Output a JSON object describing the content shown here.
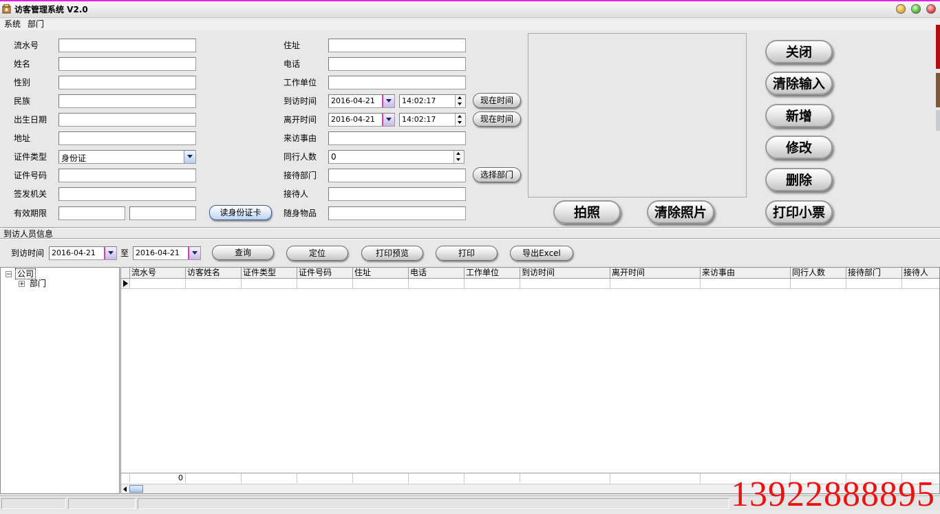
{
  "window": {
    "title": "访客管理系统 V2.0"
  },
  "menu": [
    "系统",
    "部门"
  ],
  "form": {
    "serial_label": "流水号",
    "serial_value": "",
    "name_label": "姓名",
    "name_value": "",
    "gender_label": "性别",
    "gender_value": "",
    "ethnicity_label": "民族",
    "ethnicity_value": "",
    "birthdate_label": "出生日期",
    "birthdate_value": "",
    "address_label": "地址",
    "address_value": "",
    "id_type_label": "证件类型",
    "id_type_value": "身份证",
    "id_number_label": "证件号码",
    "id_number_value": "",
    "issuer_label": "签发机关",
    "issuer_value": "",
    "validity_label": "有效期限",
    "validity_from": "",
    "validity_to": "",
    "read_card_button": "读身份证卡",
    "residence_label": "住址",
    "residence_value": "",
    "phone_label": "电话",
    "phone_value": "",
    "workplace_label": "工作单位",
    "workplace_value": "",
    "arrival_label": "到访时间",
    "arrival_date": "2016-04-21",
    "arrival_time": "14:02:17",
    "leave_label": "离开时间",
    "leave_date": "2016-04-21",
    "leave_time": "14:02:17",
    "now_button": "现在时间",
    "reason_label": "来访事由",
    "reason_value": "",
    "companions_label": "同行人数",
    "companions_value": "0",
    "host_dept_label": "接待部门",
    "host_dept_value": "",
    "select_dept_button": "选择部门",
    "host_label": "接待人",
    "host_value": "",
    "belongings_label": "随身物品",
    "belongings_value": ""
  },
  "photo_buttons": {
    "take": "拍照",
    "clear": "清除照片"
  },
  "actions": [
    "关闭",
    "清除输入",
    "新增",
    "修改",
    "删除",
    "打印小票"
  ],
  "section_title": "到访人员信息",
  "query": {
    "label": "到访时间",
    "from": "2016-04-21",
    "to_label": "至",
    "to": "2016-04-21",
    "buttons": [
      "查询",
      "定位",
      "打印预览",
      "打印",
      "导出Excel"
    ]
  },
  "tree": {
    "root": "公司",
    "child": "部门"
  },
  "grid": {
    "columns": [
      "流水号",
      "访客姓名",
      "证件类型",
      "证件号码",
      "住址",
      "电话",
      "工作单位",
      "到访时间",
      "离开时间",
      "来访事由",
      "同行人数",
      "接待部门",
      "接待人"
    ],
    "footer_count": "0"
  },
  "overlay_phone": "13922888895",
  "colors": {
    "overlay_red": "#ee1111",
    "title_stripe": "#e020e0"
  }
}
